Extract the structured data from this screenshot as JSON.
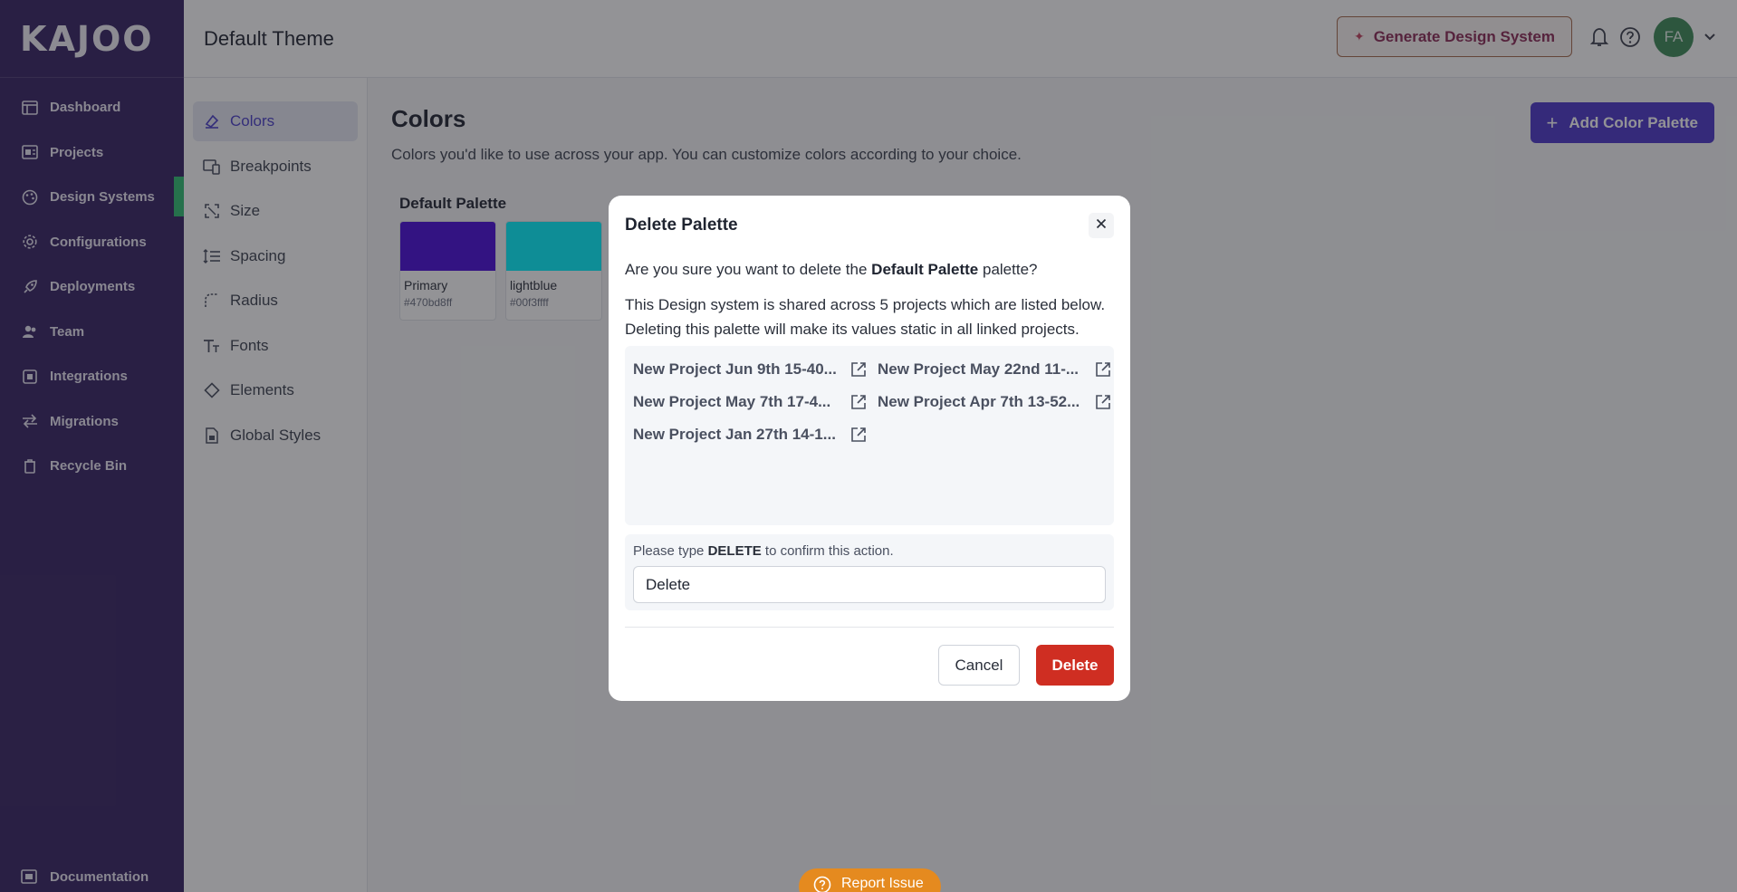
{
  "brand": {
    "logo_text": "KAJOO"
  },
  "sidebar": {
    "items": [
      {
        "label": "Dashboard",
        "icon": "dashboard-icon"
      },
      {
        "label": "Projects",
        "icon": "projects-icon"
      },
      {
        "label": "Design Systems",
        "icon": "palette-icon",
        "active": true
      },
      {
        "label": "Configurations",
        "icon": "gear-icon"
      },
      {
        "label": "Deployments",
        "icon": "rocket-icon"
      },
      {
        "label": "Team",
        "icon": "team-icon"
      },
      {
        "label": "Integrations",
        "icon": "integrations-icon"
      },
      {
        "label": "Migrations",
        "icon": "arrows-icon"
      },
      {
        "label": "Recycle Bin",
        "icon": "trash-icon"
      }
    ],
    "documentation": "Documentation"
  },
  "header": {
    "title": "Default Theme",
    "generate_label": "Generate Design System",
    "avatar_initials": "FA"
  },
  "subnav": {
    "items": [
      {
        "label": "Colors",
        "icon": "colors-icon",
        "active": true
      },
      {
        "label": "Breakpoints",
        "icon": "breakpoints-icon"
      },
      {
        "label": "Size",
        "icon": "size-icon"
      },
      {
        "label": "Spacing",
        "icon": "spacing-icon"
      },
      {
        "label": "Radius",
        "icon": "radius-icon"
      },
      {
        "label": "Fonts",
        "icon": "fonts-icon"
      },
      {
        "label": "Elements",
        "icon": "elements-icon"
      },
      {
        "label": "Global Styles",
        "icon": "global-styles-icon"
      }
    ]
  },
  "content": {
    "title": "Colors",
    "description": "Colors you'd like to use across your app. You can customize colors according to your choice.",
    "add_label": "Add Color Palette",
    "palette_name": "Default Palette",
    "swatches": [
      {
        "name": "Primary",
        "hex": "#470bd8ff",
        "color": "#470bd8"
      },
      {
        "name": "lightblue",
        "hex": "#00f3ffff",
        "color": "#00f3ff"
      }
    ]
  },
  "modal": {
    "title": "Delete Palette",
    "question_prefix": "Are you sure you want to delete the ",
    "question_bold": "Default Palette",
    "question_suffix": " palette?",
    "info": "This Design system is shared across 5 projects which are listed below. Deleting this palette will make its values static in all linked projects.",
    "projects": [
      "New Project Jun 9th 15-40...",
      "New Project May 22nd 11-...",
      "New Project May 7th 17-4...",
      "New Project Apr 7th 13-52...",
      "New Project Jan 27th 14-1..."
    ],
    "confirm_prefix": "Please type ",
    "confirm_keyword": "DELETE",
    "confirm_suffix": " to confirm this action.",
    "confirm_value": "Delete",
    "cancel_label": "Cancel",
    "delete_label": "Delete"
  },
  "report_issue": "Report Issue"
}
